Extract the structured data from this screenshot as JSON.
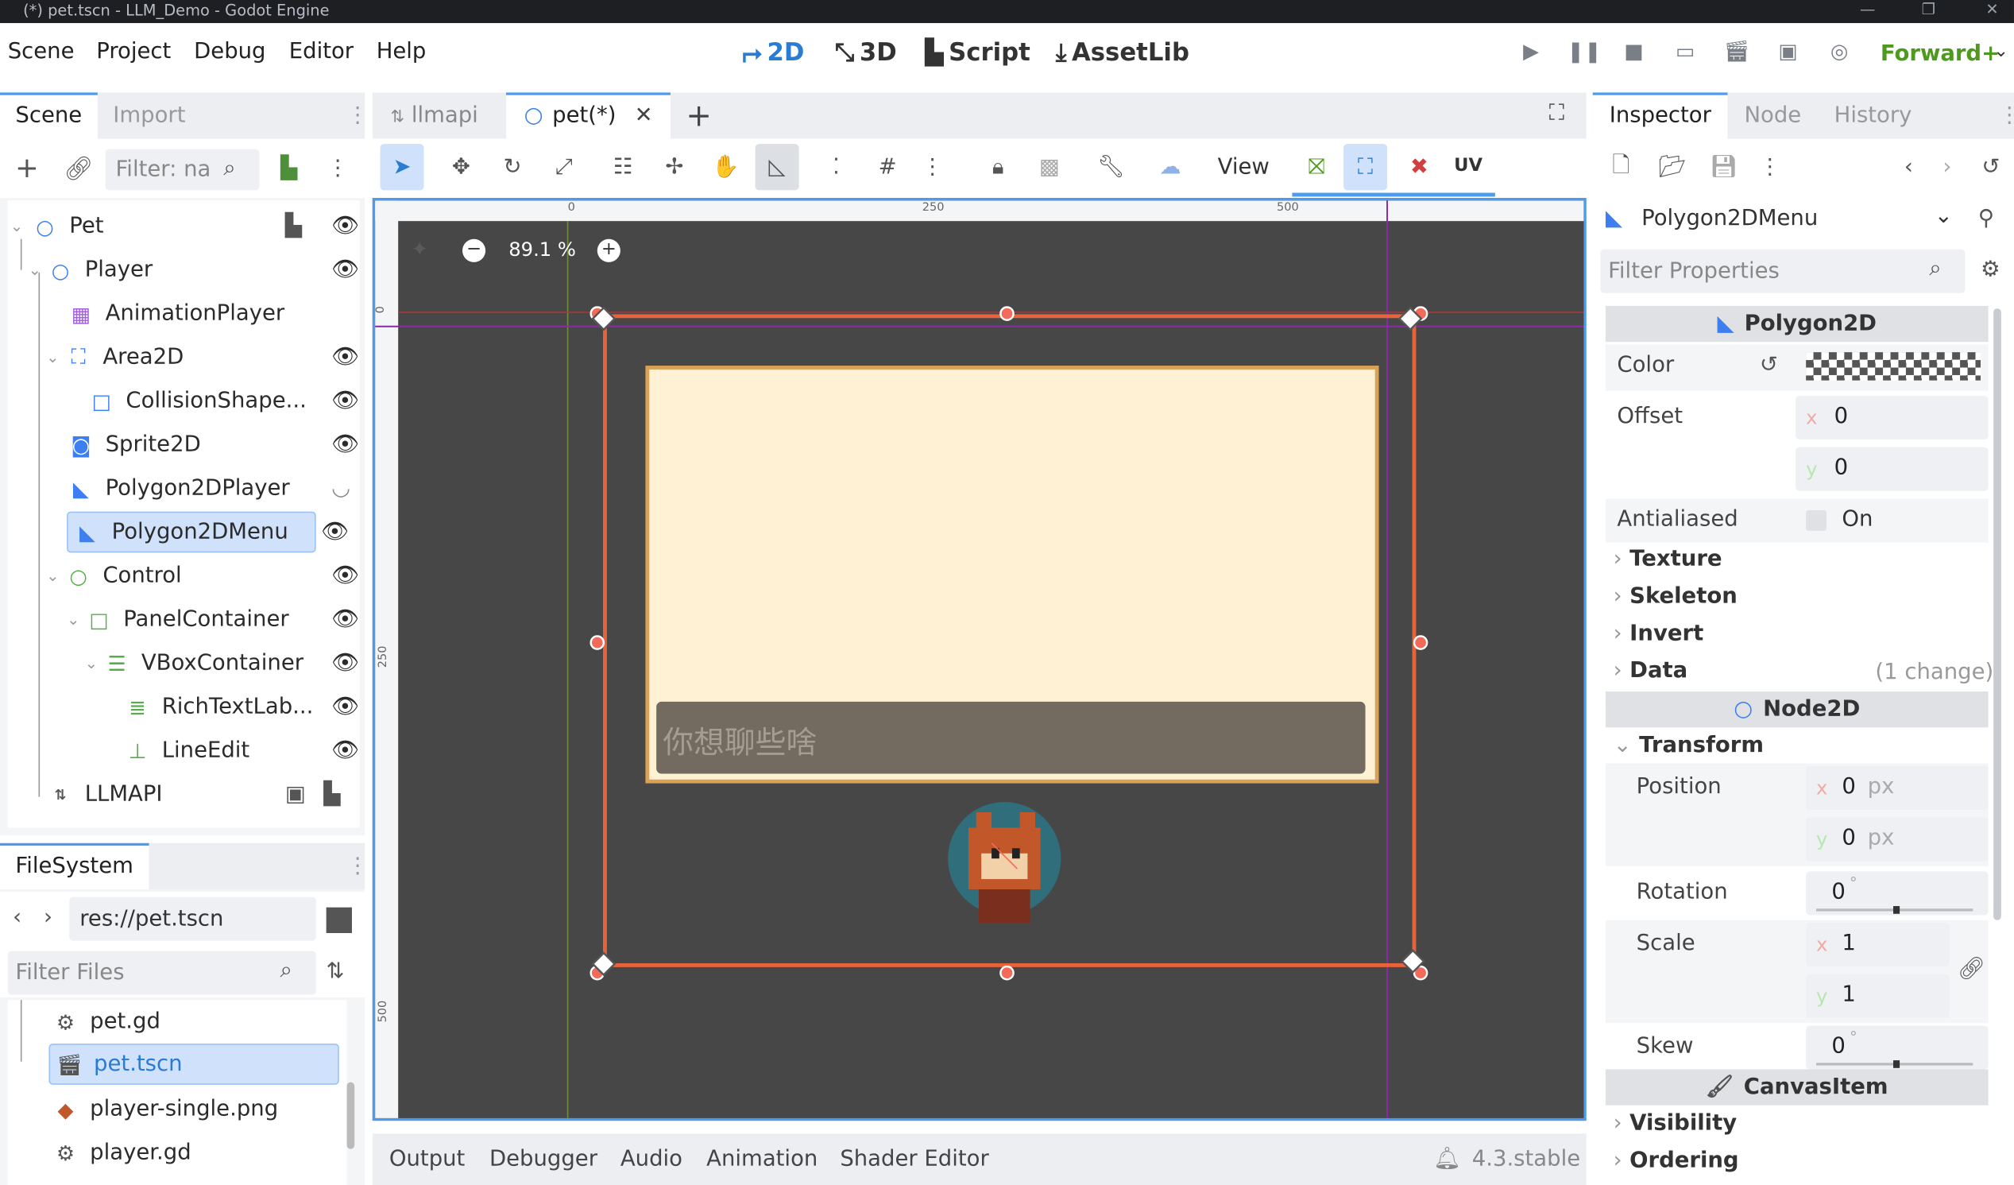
{
  "window": {
    "title": "(*) pet.tscn - LLM_Demo - Godot Engine"
  },
  "menu": [
    "Scene",
    "Project",
    "Debug",
    "Editor",
    "Help"
  ],
  "workspaces": {
    "w2d": "2D",
    "w3d": "3D",
    "script": "Script",
    "assetlib": "AssetLib"
  },
  "renderer": "Forward+",
  "scene_dock": {
    "tabs": {
      "scene": "Scene",
      "import": "Import"
    },
    "filter_placeholder": "Filter: na",
    "nodes": [
      {
        "label": "Pet"
      },
      {
        "label": "Player"
      },
      {
        "label": "AnimationPlayer"
      },
      {
        "label": "Area2D"
      },
      {
        "label": "CollisionShape..."
      },
      {
        "label": "Sprite2D"
      },
      {
        "label": "Polygon2DPlayer"
      },
      {
        "label": "Polygon2DMenu"
      },
      {
        "label": "Control"
      },
      {
        "label": "PanelContainer"
      },
      {
        "label": "VBoxContainer"
      },
      {
        "label": "RichTextLab..."
      },
      {
        "label": "LineEdit"
      },
      {
        "label": "LLMAPI"
      }
    ]
  },
  "filesystem": {
    "title": "FileSystem",
    "path": "res://pet.tscn",
    "filter_placeholder": "Filter Files",
    "files": [
      {
        "label": "pet.gd"
      },
      {
        "label": "pet.tscn"
      },
      {
        "label": "player-single.png"
      },
      {
        "label": "player.gd"
      }
    ]
  },
  "editor_tabs": {
    "llmapi": "llmapi",
    "pet": "pet(*)"
  },
  "viewport": {
    "view_label": "View",
    "uv_label": "UV",
    "zoom": "89.1 %",
    "ruler_h": [
      "0",
      "250",
      "500"
    ],
    "ruler_v": [
      "0",
      "250",
      "500"
    ],
    "line_edit_text": "你想聊些啥"
  },
  "bottom_panel": {
    "tabs": [
      "Output",
      "Debugger",
      "Audio",
      "Animation",
      "Shader Editor"
    ],
    "version": "4.3.stable"
  },
  "inspector": {
    "tabs": {
      "inspector": "Inspector",
      "node": "Node",
      "history": "History"
    },
    "object": "Polygon2DMenu",
    "filter_placeholder": "Filter Properties",
    "polygon2d_header": "Polygon2D",
    "color_label": "Color",
    "offset_label": "Offset",
    "offset_x": "0",
    "offset_y": "0",
    "antialiased_label": "Antialiased",
    "antialiased_value": "On",
    "sections": {
      "texture": "Texture",
      "skeleton": "Skeleton",
      "invert": "Invert",
      "data": "Data",
      "data_changes": "(1 change)"
    },
    "node2d_header": "Node2D",
    "transform_label": "Transform",
    "position_label": "Position",
    "position_x": "0",
    "position_y": "0",
    "px": "px",
    "rotation_label": "Rotation",
    "rotation_value": "0",
    "scale_label": "Scale",
    "scale_x": "1",
    "scale_y": "1",
    "skew_label": "Skew",
    "skew_value": "0",
    "degree": "°",
    "canvasitem_header": "CanvasItem",
    "visibility_label": "Visibility",
    "ordering_label": "Ordering",
    "x_axis": "x",
    "y_axis": "y"
  },
  "colors": {
    "accent": "#4a9cf0",
    "viewport_bg": "#474747",
    "polygon_outline": "#e8633a",
    "panel_fill": "#fff1d4",
    "panel_border": "#d9a256"
  }
}
